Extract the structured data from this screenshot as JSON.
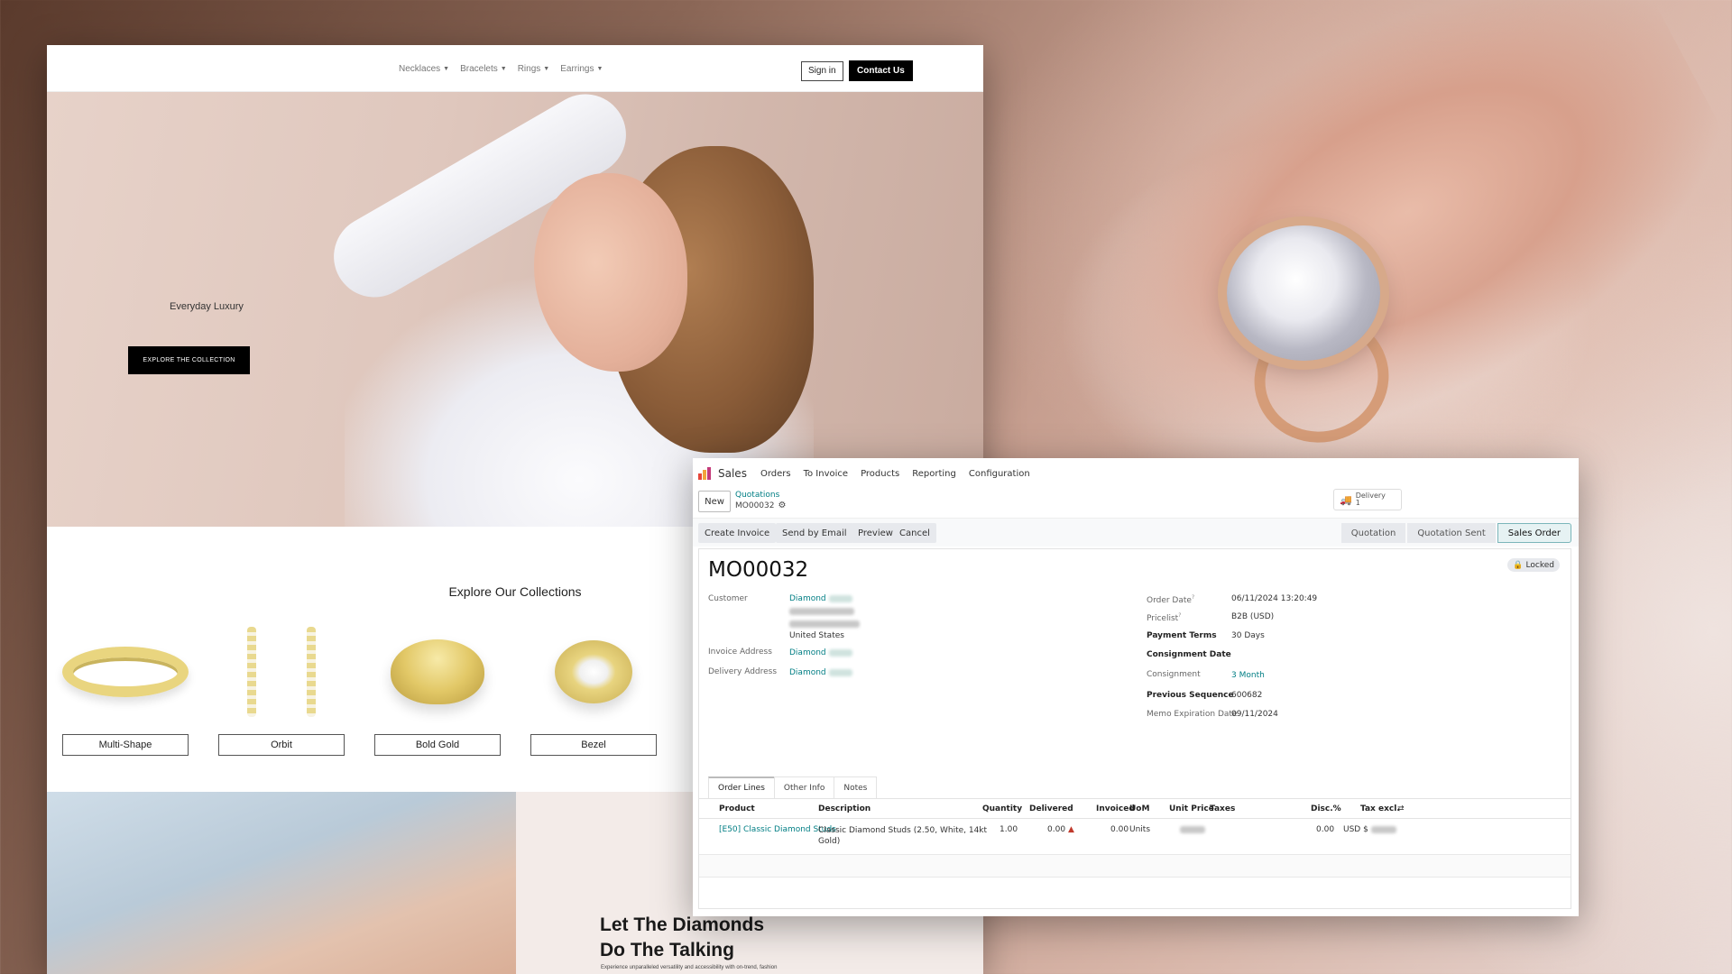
{
  "storefront": {
    "nav": {
      "menu": [
        {
          "label": "Necklaces"
        },
        {
          "label": "Bracelets"
        },
        {
          "label": "Rings"
        },
        {
          "label": "Earrings"
        }
      ],
      "signin_label": "Sign in",
      "contact_label": "Contact Us"
    },
    "hero": {
      "title": "Everyday Luxury",
      "cta_label": "EXPLORE THE COLLECTION"
    },
    "collections": {
      "title": "Explore Our Collections",
      "items": [
        {
          "label": "Multi-Shape"
        },
        {
          "label": "Orbit"
        },
        {
          "label": "Bold Gold"
        },
        {
          "label": "Bezel"
        }
      ]
    },
    "feature": {
      "title_line1": "Let The Diamonds",
      "title_line2": "Do The Talking",
      "subtitle": "Experience unparalleled versatility and accessibility with on-trend, fashion"
    }
  },
  "odoo": {
    "app_name": "Sales",
    "top_menu": [
      "Orders",
      "To Invoice",
      "Products",
      "Reporting",
      "Configuration"
    ],
    "new_label": "New",
    "breadcrumb": {
      "parent": "Quotations",
      "current": "MO00032"
    },
    "smart_button": {
      "label": "Delivery",
      "count": "1"
    },
    "actions": [
      "Create Invoice",
      "Send by Email",
      "Preview",
      "Cancel"
    ],
    "stages": [
      {
        "label": "Quotation",
        "active": false
      },
      {
        "label": "Quotation Sent",
        "active": false
      },
      {
        "label": "Sales Order",
        "active": true
      }
    ],
    "locked_label": "Locked",
    "order_name": "MO00032",
    "left_fields": {
      "customer_label": "Customer",
      "customer_name": "Diamond",
      "customer_country": "United States",
      "invoice_label": "Invoice Address",
      "invoice_value": "Diamond",
      "delivery_label": "Delivery Address",
      "delivery_value": "Diamond"
    },
    "right_fields": [
      {
        "label": "Order Date",
        "value": "06/11/2024 13:20:49",
        "help": "?",
        "bold": false,
        "link": false
      },
      {
        "label": "Pricelist",
        "value": "B2B (USD)",
        "help": "?",
        "bold": false,
        "link": false
      },
      {
        "label": "Payment Terms",
        "value": "30 Days",
        "bold": true,
        "link": false
      },
      {
        "label": "Consignment Date",
        "value": "",
        "bold": true,
        "link": false
      },
      {
        "label": "Consignment",
        "value": "3 Month",
        "bold": false,
        "link": true
      },
      {
        "label": "Previous Sequence",
        "value": "600682",
        "bold": true,
        "link": false
      },
      {
        "label": "Memo Expiration Date",
        "value": "09/11/2024",
        "bold": false,
        "link": false
      }
    ],
    "tabs": [
      {
        "label": "Order Lines",
        "active": true
      },
      {
        "label": "Other Info",
        "active": false
      },
      {
        "label": "Notes",
        "active": false
      }
    ],
    "columns": {
      "product": "Product",
      "description": "Description",
      "quantity": "Quantity",
      "delivered": "Delivered",
      "invoiced": "Invoiced",
      "uom": "UoM",
      "unit_price": "Unit Price",
      "taxes": "Taxes",
      "discount": "Disc.%",
      "tax_excl": "Tax excl."
    },
    "lines": [
      {
        "product": "[E50] Classic Diamond Studs",
        "description_line1": "Classic Diamond Studs (2.50, White, 14kt",
        "description_line2": "Gold)",
        "quantity": "1.00",
        "delivered": "0.00",
        "invoiced": "0.00",
        "uom": "Units",
        "discount": "0.00",
        "currency_prefix": "USD $"
      }
    ]
  }
}
